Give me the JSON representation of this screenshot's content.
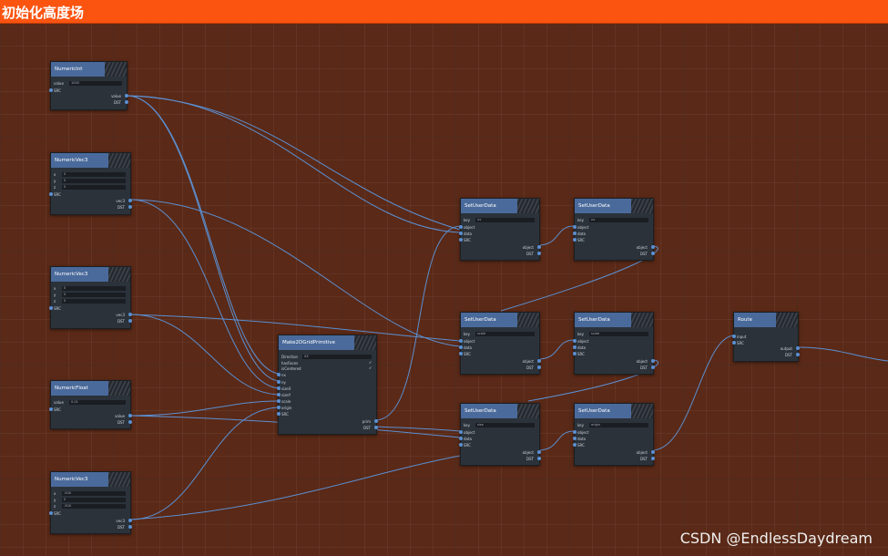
{
  "title": "初始化高度场",
  "watermark": "CSDN @EndlessDaydream",
  "colors": {
    "background": "#5a2917",
    "title_bar": "#fb5411",
    "node_header": "#4a6a9b",
    "node_body": "#2b323a",
    "wire": "#5b8fd1"
  },
  "nodes": {
    "numeric_int": {
      "title": "NumericInt",
      "value_label": "value",
      "value": "1000",
      "src": "SRC",
      "out": "value",
      "dst": "DST"
    },
    "vec3_a": {
      "title": "NumericVec3",
      "x": "x",
      "y": "y",
      "z": "z",
      "xv": "0",
      "yv": "0",
      "zv": "0",
      "src": "SRC",
      "out": "vec3",
      "dst": "DST"
    },
    "vec3_b": {
      "title": "NumericVec3",
      "x": "x",
      "y": "y",
      "z": "z",
      "xv": "0",
      "yv": "0",
      "zv": "0",
      "src": "SRC",
      "out": "vec3",
      "dst": "DST"
    },
    "numeric_float": {
      "title": "NumericFloat",
      "value_label": "value",
      "value": "0.01",
      "src": "SRC",
      "out": "value",
      "dst": "DST"
    },
    "vec3_c": {
      "title": "NumericVec3",
      "x": "x",
      "y": "y",
      "z": "z",
      "xv": "-500",
      "yv": "0",
      "zv": "-500",
      "src": "SRC",
      "out": "vec3",
      "dst": "DST"
    },
    "grid": {
      "title": "Make2DGridPrimitive",
      "direction_label": "Direction",
      "direction": "XZ",
      "has_faces": "hasFaces",
      "is_centered": "isCentered",
      "inputs": [
        "nx",
        "ny",
        "sizeX",
        "sizeY",
        "scale",
        "origin",
        "SRC"
      ],
      "out": "prim",
      "dst": "DST"
    },
    "sud_1": {
      "title": "SetUserData",
      "key_label": "key",
      "key": "nx",
      "inputs": [
        "object",
        "data",
        "SRC"
      ],
      "out": "object",
      "dst": "DST"
    },
    "sud_2": {
      "title": "SetUserData",
      "key_label": "key",
      "key": "nz",
      "inputs": [
        "object",
        "data",
        "SRC"
      ],
      "out": "object",
      "dst": "DST"
    },
    "sud_3": {
      "title": "SetUserData",
      "key_label": "key",
      "key": "scale",
      "inputs": [
        "object",
        "data",
        "SRC"
      ],
      "out": "object",
      "dst": "DST"
    },
    "sud_4": {
      "title": "SetUserData",
      "key_label": "key",
      "key": "scale",
      "inputs": [
        "object",
        "data",
        "SRC"
      ],
      "out": "object",
      "dst": "DST"
    },
    "sud_5": {
      "title": "SetUserData",
      "key_label": "key",
      "key": "size",
      "inputs": [
        "object",
        "data",
        "SRC"
      ],
      "out": "object",
      "dst": "DST"
    },
    "sud_6": {
      "title": "SetUserData",
      "key_label": "key",
      "key": "origin",
      "inputs": [
        "object",
        "data",
        "SRC"
      ],
      "out": "object",
      "dst": "DST"
    },
    "route": {
      "title": "Route",
      "inputs": [
        "input",
        "SRC"
      ],
      "out": "output",
      "dst": "DST"
    }
  }
}
